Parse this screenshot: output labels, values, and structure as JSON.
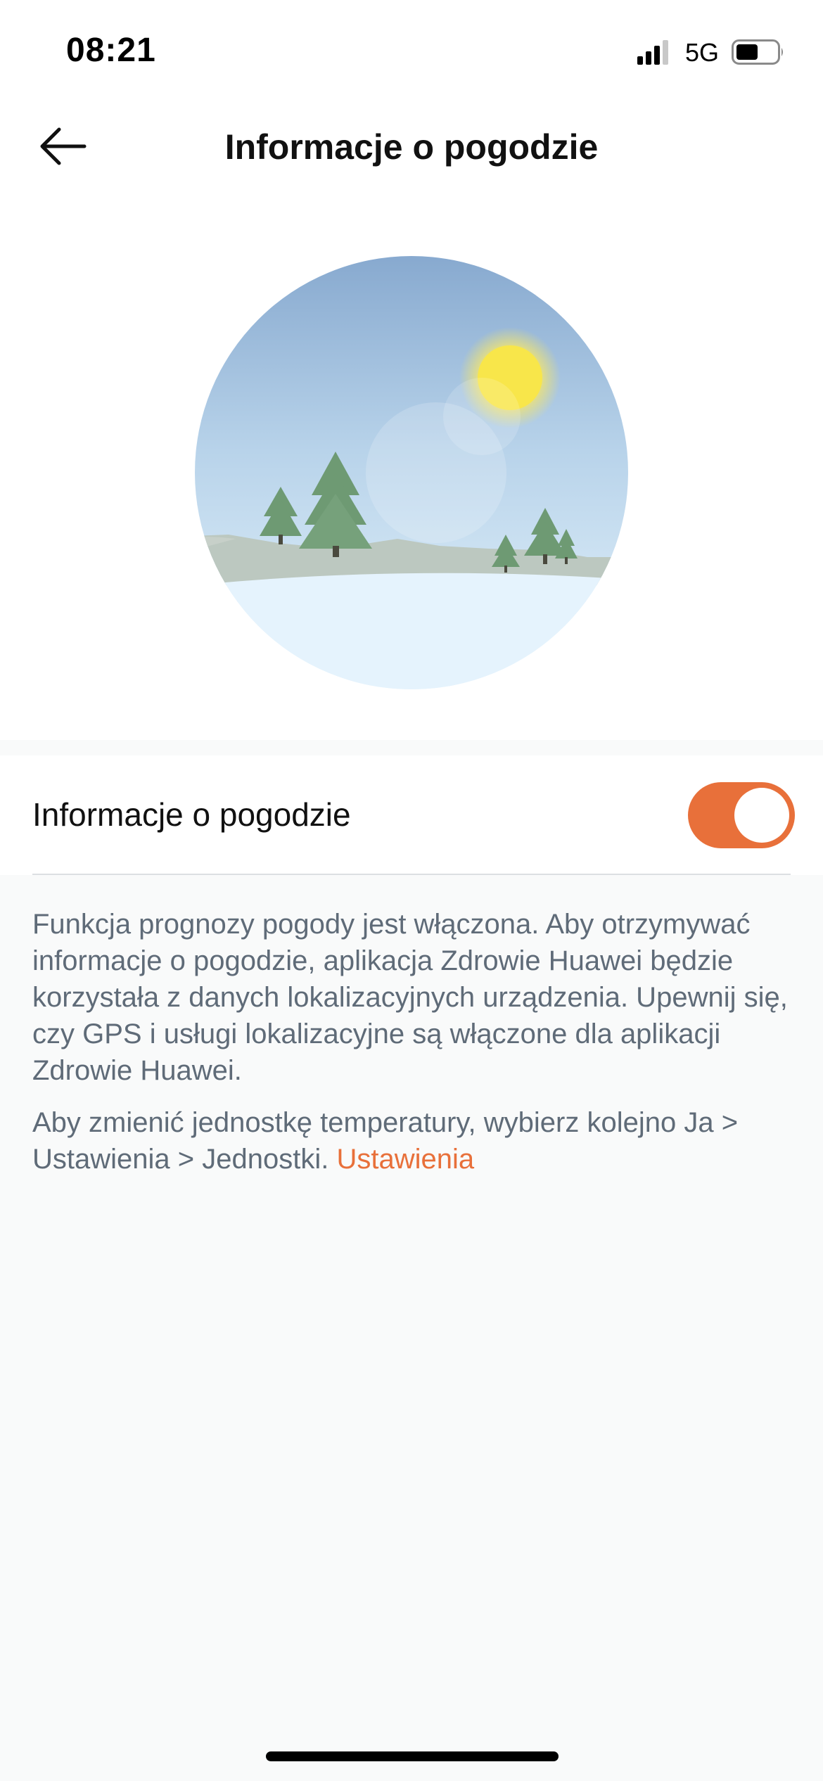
{
  "status_bar": {
    "time": "08:21",
    "network": "5G",
    "icons": [
      "signal-icon",
      "battery-icon"
    ]
  },
  "header": {
    "title": "Informacje o pogodzie",
    "back_icon": "arrow-left-icon"
  },
  "illustration": {
    "description_icon": "weather-landscape-illustration",
    "sky_top": "#87a9cf",
    "sky_bottom": "#dff0fb",
    "sun_color": "#f8e64a",
    "tree_color": "#6e9a73",
    "snow_color": "#e5f3fd"
  },
  "settings": {
    "weather_toggle": {
      "label": "Informacje o pogodzie",
      "enabled": true,
      "on_color": "#e8703a"
    }
  },
  "description": {
    "paragraph1": "Funkcja prognozy pogody jest włączona. Aby otrzymywać informacje o pogodzie, aplikacja Zdrowie Huawei będzie korzystała z danych lokalizacyjnych urządzenia. Upewnij się, czy GPS i usługi lokalizacyjne są włączone dla aplikacji Zdrowie Huawei.",
    "paragraph2": "Aby zmienić jednostkę temperatury, wybierz kolejno Ja > Ustawienia > Jednostki.",
    "link_label": "Ustawienia",
    "link_color": "#e8703a"
  }
}
